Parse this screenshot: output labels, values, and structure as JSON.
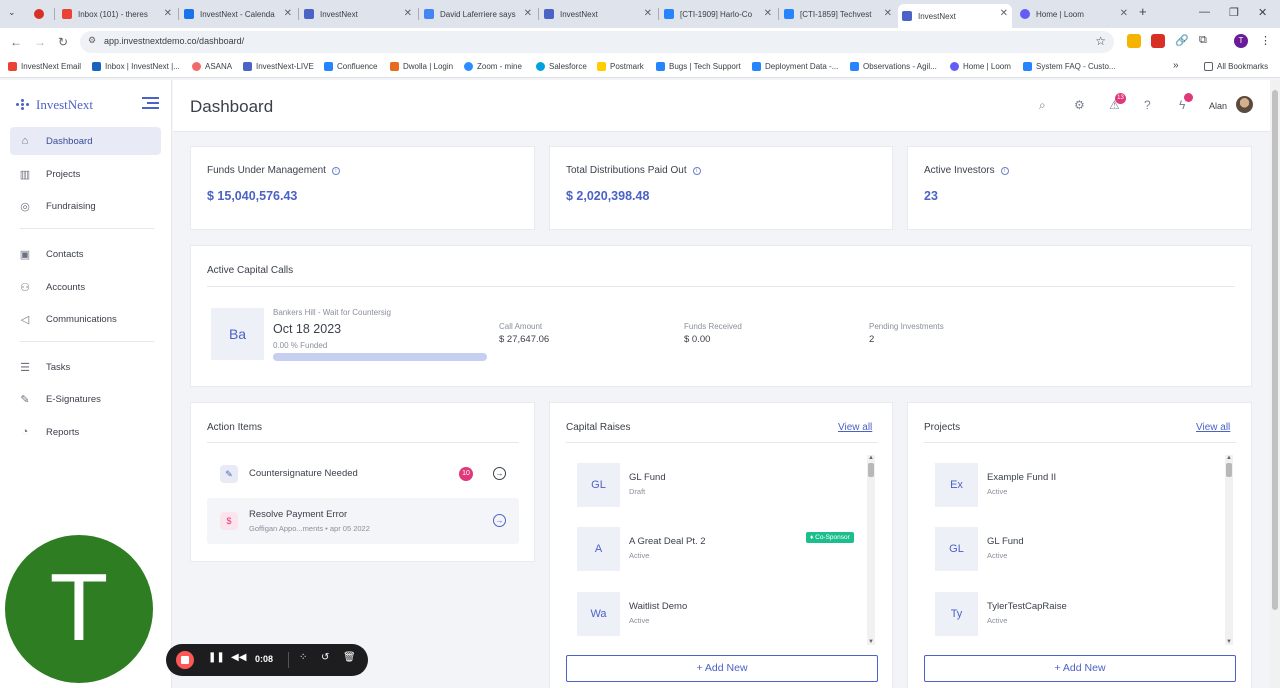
{
  "browser": {
    "tabs": [
      {
        "title": "",
        "icon": "record-icon",
        "color": "#d93025"
      },
      {
        "title": "Inbox (101) - theres",
        "icon": "gmail-icon",
        "color": "#ea4335"
      },
      {
        "title": "InvestNext - Calenda",
        "icon": "calendar-icon",
        "color": "#1a73e8"
      },
      {
        "title": "InvestNext",
        "icon": "investnext-icon",
        "color": "#4b62c6"
      },
      {
        "title": "David Laferriere says",
        "icon": "doc-icon",
        "color": "#4285f4"
      },
      {
        "title": "InvestNext",
        "icon": "investnext-icon",
        "color": "#4b62c6"
      },
      {
        "title": "[CTI-1909] Harlo-Co",
        "icon": "jira-icon",
        "color": "#2684ff"
      },
      {
        "title": "[CTI-1859] Techvest",
        "icon": "jira-icon",
        "color": "#2684ff"
      },
      {
        "title": "InvestNext",
        "icon": "investnext-icon",
        "color": "#4b62c6"
      },
      {
        "title": "Home | Loom",
        "icon": "loom-icon",
        "color": "#625df5"
      }
    ],
    "url": "app.investnextdemo.co/dashboard/",
    "bookmarks": [
      {
        "label": "InvestNext Email",
        "color": "#ea4335"
      },
      {
        "label": "Inbox | InvestNext |...",
        "color": "#1565c0"
      },
      {
        "label": "ASANA",
        "color": "#f06a6a"
      },
      {
        "label": "InvestNext-LIVE",
        "color": "#4b62c6"
      },
      {
        "label": "Confluence",
        "color": "#2684ff"
      },
      {
        "label": "Dwolla | Login",
        "color": "#e56b1f"
      },
      {
        "label": "Zoom - mine",
        "color": "#2d8cff"
      },
      {
        "label": "Salesforce",
        "color": "#00a1e0"
      },
      {
        "label": "Postmark",
        "color": "#ffcc00"
      },
      {
        "label": "Bugs | Tech Support",
        "color": "#2684ff"
      },
      {
        "label": "Deployment Data -...",
        "color": "#2684ff"
      },
      {
        "label": "Observations - Agil...",
        "color": "#2684ff"
      },
      {
        "label": "Home | Loom",
        "color": "#625df5"
      },
      {
        "label": "System FAQ - Custo...",
        "color": "#2684ff"
      }
    ],
    "all_bookmarks": "All Bookmarks"
  },
  "app": {
    "brand": "InvestNext",
    "page_title": "Dashboard",
    "user_name": "Alan",
    "notification_count": "13",
    "sidebar": [
      {
        "label": "Dashboard",
        "icon": "home-icon",
        "glyph": "⌂"
      },
      {
        "label": "Projects",
        "icon": "building-icon",
        "glyph": "▥"
      },
      {
        "label": "Fundraising",
        "icon": "coins-icon",
        "glyph": "◎"
      },
      {
        "label": "Contacts",
        "icon": "contact-card-icon",
        "glyph": "▣"
      },
      {
        "label": "Accounts",
        "icon": "users-icon",
        "glyph": "⚇"
      },
      {
        "label": "Communications",
        "icon": "megaphone-icon",
        "glyph": "◁"
      },
      {
        "label": "Tasks",
        "icon": "list-icon",
        "glyph": "☰"
      },
      {
        "label": "E-Signatures",
        "icon": "signature-icon",
        "glyph": "✎"
      },
      {
        "label": "Reports",
        "icon": "chart-pie-icon",
        "glyph": "◔"
      }
    ]
  },
  "stats": [
    {
      "title": "Funds Under Management",
      "value": "$ 15,040,576.43"
    },
    {
      "title": "Total Distributions Paid Out",
      "value": "$ 2,020,398.48"
    },
    {
      "title": "Active Investors",
      "value": "23"
    }
  ],
  "capital_calls": {
    "title": "Active Capital Calls",
    "tile": "Ba",
    "name": "Bankers Hill - Wait for Countersig",
    "date": "Oct 18 2023",
    "funded_text": "0.00 % Funded",
    "funded_fraction": 0.0,
    "call_amount_label": "Call Amount",
    "call_amount": "$ 27,647.06",
    "funds_received_label": "Funds Received",
    "funds_received": "$ 0.00",
    "pending_label": "Pending Investments",
    "pending": "2"
  },
  "action_items": {
    "title": "Action Items",
    "items": [
      {
        "label": "Countersignature Needed",
        "badge": "10"
      },
      {
        "label": "Resolve Payment Error",
        "sub": "Goffigan Appo...ments • apr 05 2022"
      }
    ]
  },
  "capital_raises": {
    "title": "Capital Raises",
    "view_all": "View all",
    "add_new": "+ Add New",
    "items": [
      {
        "tile": "GL",
        "name": "GL Fund",
        "status": "Draft"
      },
      {
        "tile": "A",
        "name": "A Great Deal Pt. 2",
        "status": "Active",
        "badge": "Co-Sponsor"
      },
      {
        "tile": "Wa",
        "name": "Waitlist Demo",
        "status": "Active"
      }
    ]
  },
  "projects": {
    "title": "Projects",
    "view_all": "View all",
    "add_new": "+ Add New",
    "items": [
      {
        "tile": "Ex",
        "name": "Example Fund II",
        "status": "Active"
      },
      {
        "tile": "GL",
        "name": "GL Fund",
        "status": "Active"
      },
      {
        "tile": "Ty",
        "name": "TylerTestCapRaise",
        "status": "Active"
      }
    ]
  },
  "recorder": {
    "avatar_letter": "T",
    "time": "0:08",
    "accent": "#2e7d23"
  }
}
